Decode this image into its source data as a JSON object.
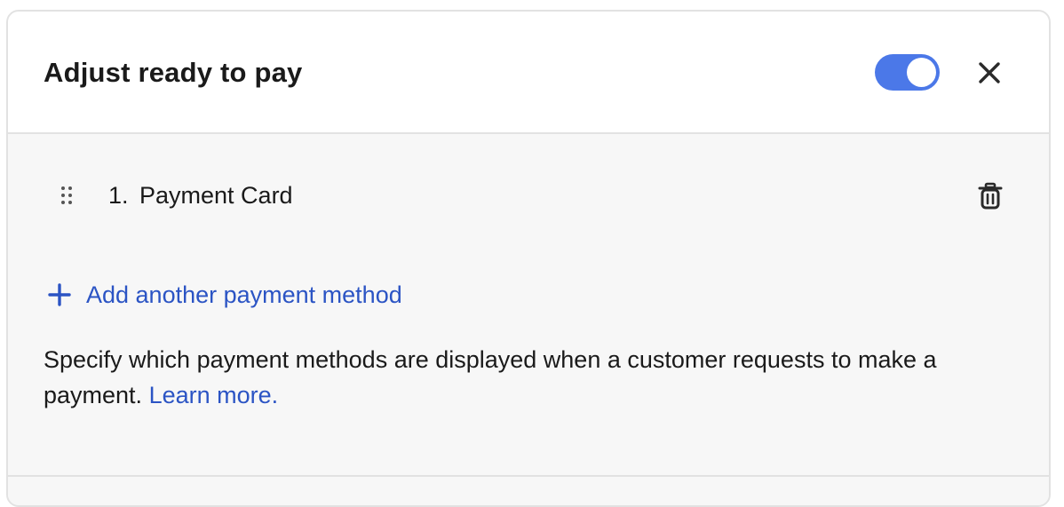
{
  "dialog": {
    "title": "Adjust ready to pay",
    "toggle_on": true,
    "accent_color": "#4b78e8",
    "link_color": "#2b54c4"
  },
  "payment_methods": [
    {
      "number": "1.",
      "label": "Payment Card"
    }
  ],
  "add_method_label": "Add another payment method",
  "description": {
    "text": "Specify which payment methods are displayed when a customer requests to make a payment. ",
    "link": "Learn more."
  },
  "icons": {
    "close": "close-icon",
    "drag": "drag-handle-icon",
    "delete": "trash-icon",
    "add": "plus-icon"
  }
}
